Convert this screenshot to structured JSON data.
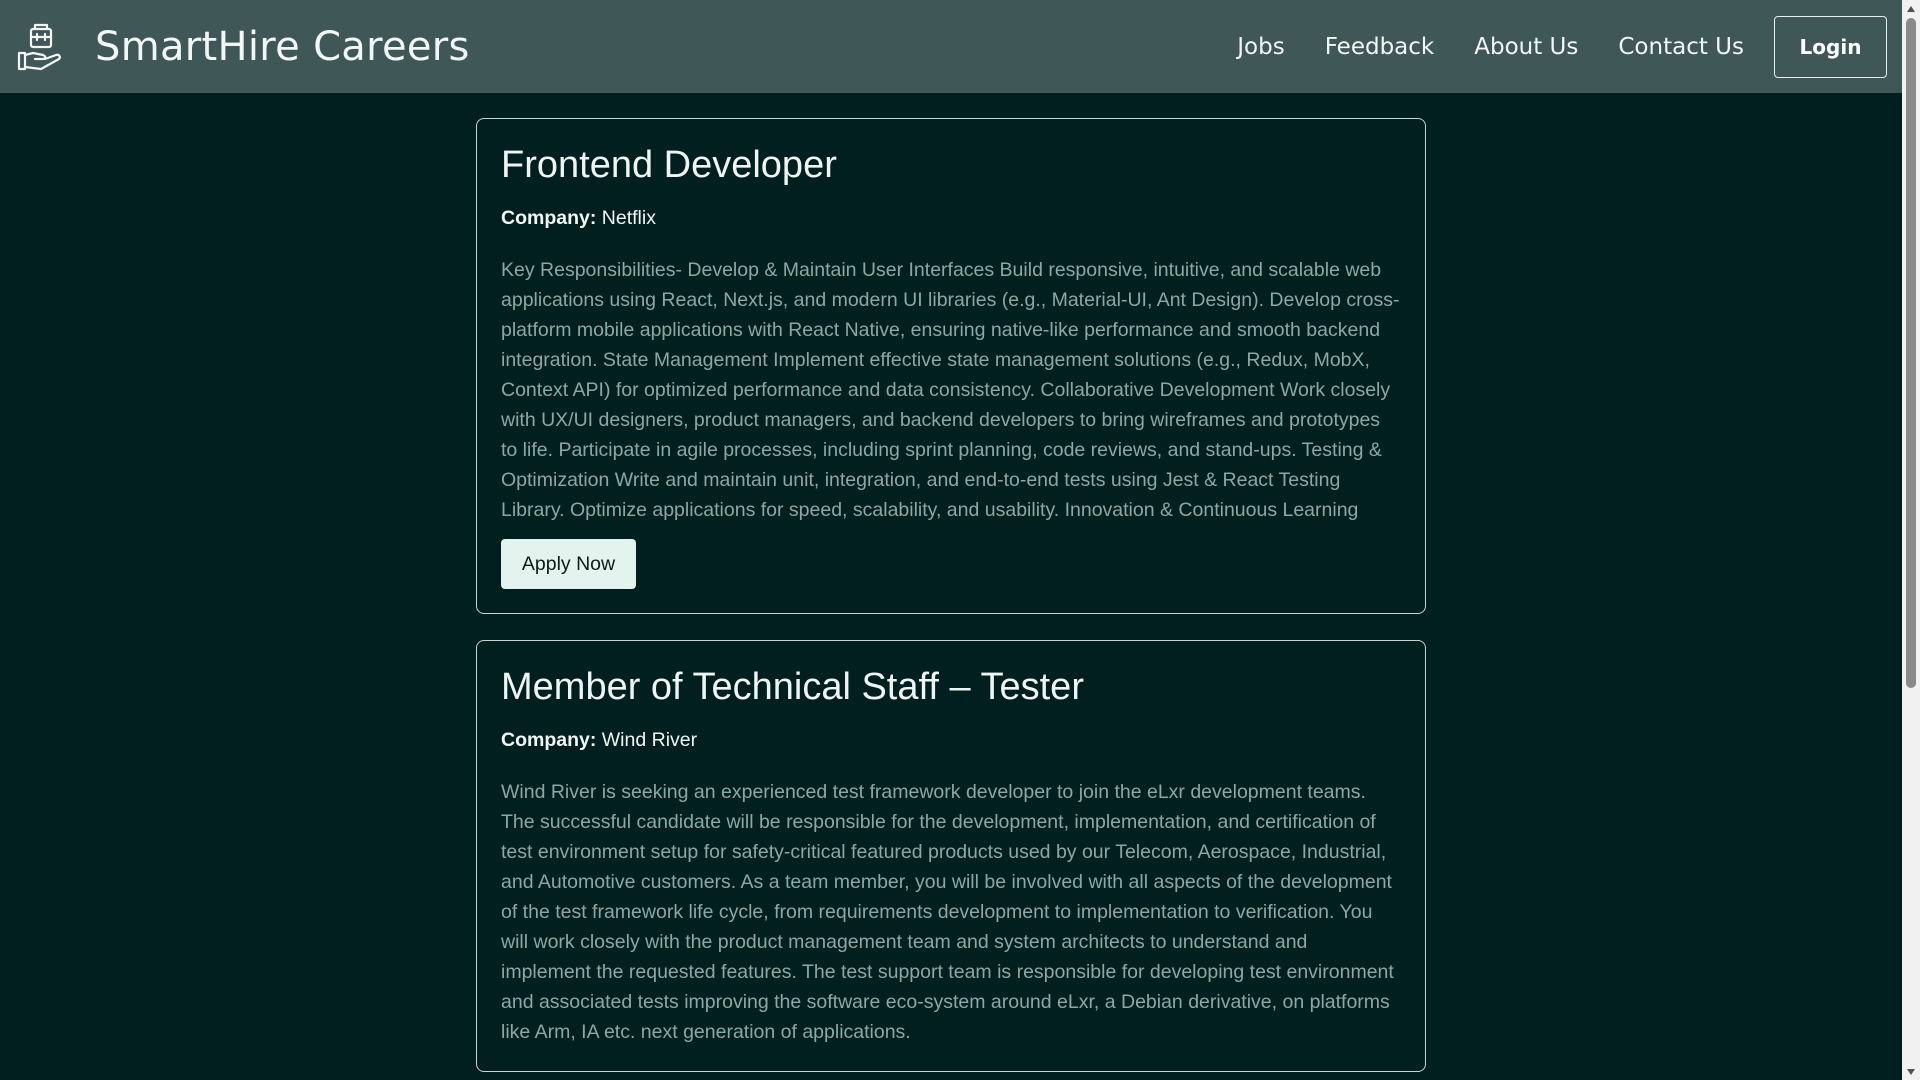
{
  "header": {
    "brand": "SmartHire Careers",
    "logo_icon": "briefcase-hand-icon",
    "nav": [
      "Jobs",
      "Feedback",
      "About Us",
      "Contact Us"
    ],
    "login_label": "Login"
  },
  "jobs": [
    {
      "title": "Frontend Developer",
      "company_label": "Company:",
      "company": "Netflix",
      "description": "Key Responsibilities- Develop & Maintain User Interfaces Build responsive, intuitive, and scalable web applications using React, Next.js, and modern UI libraries (e.g., Material-UI, Ant Design). Develop cross-platform mobile applications with React Native, ensuring native-like performance and smooth backend integration. State Management Implement effective state management solutions (e.g., Redux, MobX, Context API) for optimized performance and data consistency. Collaborative Development Work closely with UX/UI designers, product managers, and backend developers to bring wireframes and prototypes to life. Participate in agile processes, including sprint planning, code reviews, and stand-ups. Testing & Optimization Write and maintain unit, integration, and end-to-end tests using Jest & React Testing Library. Optimize applications for speed, scalability, and usability. Innovation & Continuous Learning",
      "apply_label": "Apply Now"
    },
    {
      "title": "Member of Technical Staff – Tester",
      "company_label": "Company:",
      "company": "Wind River",
      "description": "Wind River is seeking an experienced test framework developer to join the eLxr development teams. The successful candidate will be responsible for the development, implementation, and certification of test environment setup for safety-critical featured products used by our Telecom, Aerospace, Industrial, and Automotive customers. As a team member, you will be involved with all aspects of the development of the test framework life cycle, from requirements development to implementation to verification. You will work closely with the product management team and system architects to understand and implement the requested features. The test support team is responsible for developing test environment and associated tests improving the software eco-system around eLxr, a Debian derivative, on platforms like Arm, IA etc. next generation of applications."
    }
  ],
  "colors": {
    "background": "#021f1f",
    "navbar": "#3f5756",
    "description_text": "#8da8a3",
    "apply_button": "#e3f4ee"
  }
}
